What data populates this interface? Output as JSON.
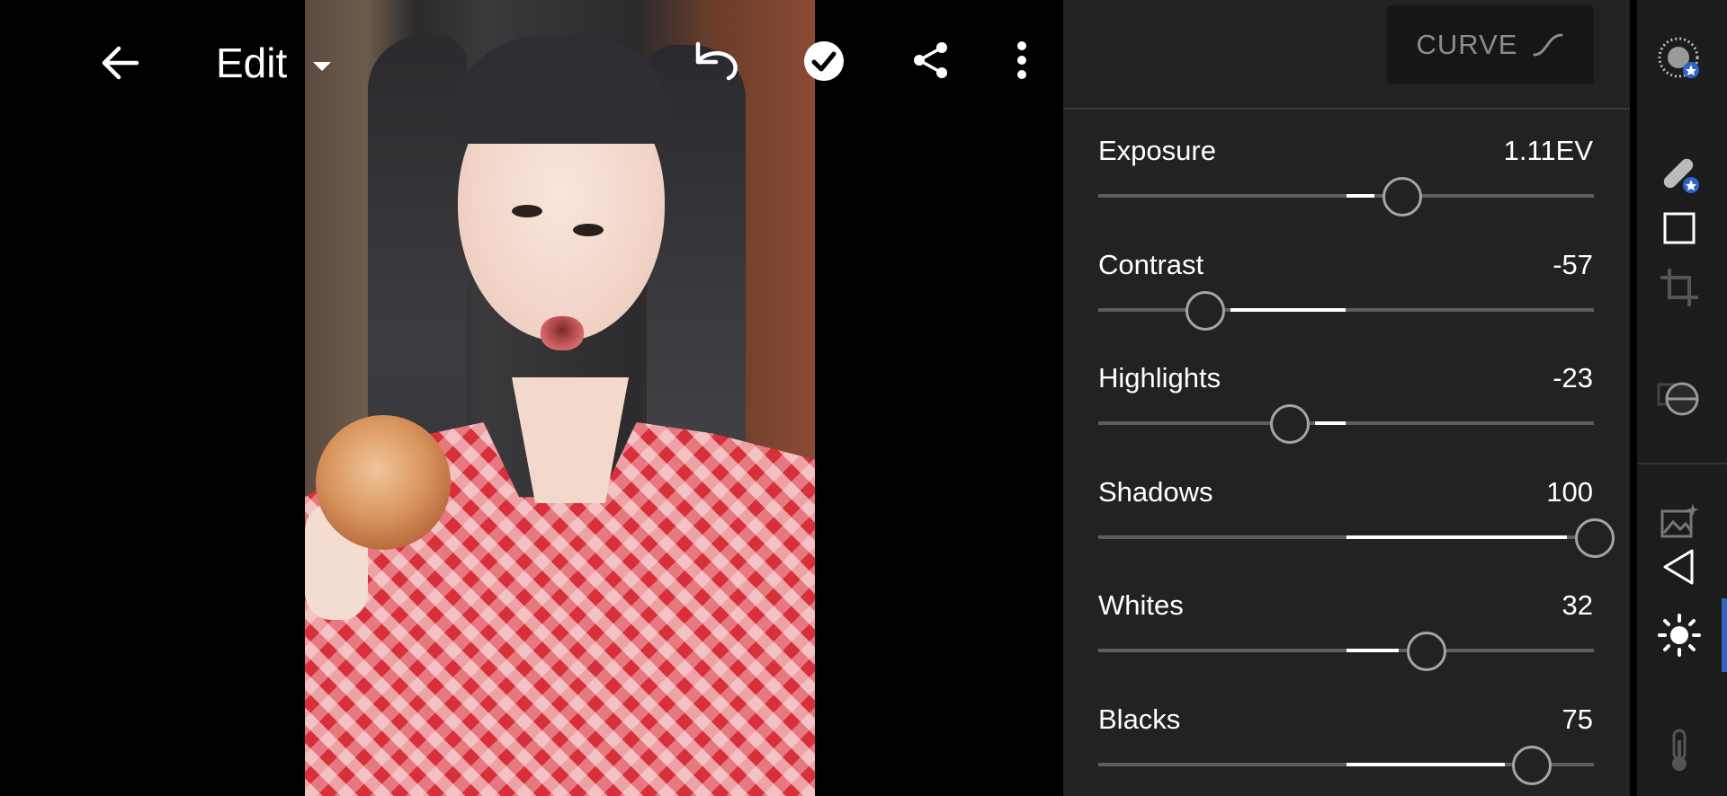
{
  "header": {
    "title": "Edit",
    "back_icon": "arrow-left-icon",
    "dropdown_icon": "caret-down-icon",
    "undo_icon": "undo-icon",
    "done_icon": "check-circle-icon",
    "share_icon": "share-icon",
    "more_icon": "more-vertical-icon"
  },
  "panel": {
    "curve_label": "CURVE",
    "sliders": [
      {
        "label": "Exposure",
        "value": "1.11EV",
        "level": 0.611,
        "fill_from": 0.5,
        "fill_to": 0.558
      },
      {
        "label": "Contrast",
        "value": "-57",
        "level": 0.215,
        "fill_from": 0.267,
        "fill_to": 0.5
      },
      {
        "label": "Highlights",
        "value": "-23",
        "level": 0.385,
        "fill_from": 0.438,
        "fill_to": 0.5
      },
      {
        "label": "Shadows",
        "value": "100",
        "level": 1.0,
        "fill_from": 0.5,
        "fill_to": 0.946
      },
      {
        "label": "Whites",
        "value": "32",
        "level": 0.66,
        "fill_from": 0.5,
        "fill_to": 0.607
      },
      {
        "label": "Blacks",
        "value": "75",
        "level": 0.873,
        "fill_from": 0.5,
        "fill_to": 0.82
      }
    ]
  },
  "toolstrip": {
    "tools": [
      "presets-icon",
      "healing-icon",
      "crop-square-icon",
      "crop-icon",
      "selective-mask-icon",
      "image-adjust-icon",
      "triangle-play-icon",
      "light-sun-icon",
      "temperature-icon"
    ]
  },
  "colors": {
    "panel_bg": "#222222",
    "accent": "#2e64c8",
    "track": "#5e5e5e"
  }
}
